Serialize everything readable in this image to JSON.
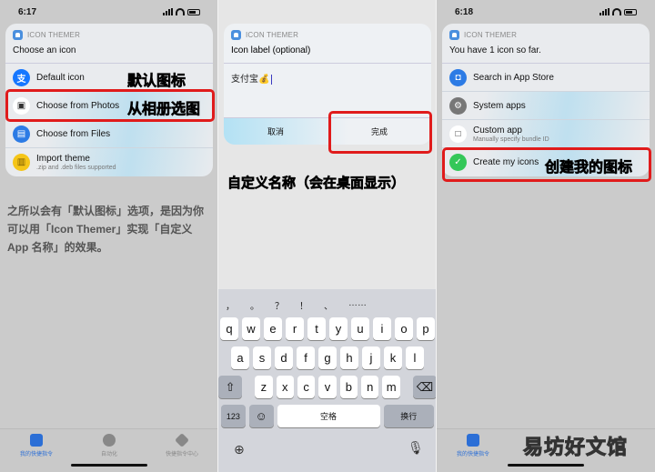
{
  "colors": {
    "accent": "#2c7be5",
    "highlight": "#e01b1b",
    "green": "#34c759"
  },
  "panel1": {
    "status": {
      "time": "6:17"
    },
    "app_name": "ICON THEMER",
    "title": "Choose an icon",
    "items": [
      {
        "label": "Default icon",
        "icon": "alipay-icon"
      },
      {
        "label": "Choose from Photos",
        "icon": "photos-icon"
      },
      {
        "label": "Choose from Files",
        "icon": "files-icon"
      },
      {
        "label": "Import theme",
        "sub": ".zip and .deb files supported",
        "icon": "theme-icon"
      }
    ],
    "annotations": [
      "默认图标",
      "从相册选图"
    ],
    "caption": "之所以会有「默认图标」选项，是因为你可以用「Icon Themer」实现「自定义 App 名称」的效果。",
    "tabs": [
      {
        "label": "我的快捷指令"
      },
      {
        "label": "自动化"
      },
      {
        "label": "快捷指令中心"
      }
    ]
  },
  "panel2": {
    "app_name": "ICON THEMER",
    "title": "Icon label (optional)",
    "input_value": "支付宝💰",
    "cancel": "取消",
    "done": "完成",
    "annotation": "自定义名称（会在桌面显示）",
    "candidates": [
      "，",
      "。",
      "？",
      "！",
      "、",
      "……"
    ],
    "rows": [
      [
        "q",
        "w",
        "e",
        "r",
        "t",
        "y",
        "u",
        "i",
        "o",
        "p"
      ],
      [
        "a",
        "s",
        "d",
        "f",
        "g",
        "h",
        "j",
        "k",
        "l"
      ],
      [
        "z",
        "x",
        "c",
        "v",
        "b",
        "n",
        "m"
      ]
    ],
    "key_123": "123",
    "key_space": "空格",
    "key_return": "换行"
  },
  "panel3": {
    "status": {
      "time": "6:18"
    },
    "app_name": "ICON THEMER",
    "title": "You have 1 icon so far.",
    "items": [
      {
        "label": "Search in App Store"
      },
      {
        "label": "System apps"
      },
      {
        "label": "Custom app",
        "sub": "Manually specify bundle ID"
      },
      {
        "label": "Create my icons"
      }
    ],
    "annotation": "创建我的图标",
    "tab_label": "我的快捷指令",
    "watermark": "易坊好文馆"
  }
}
